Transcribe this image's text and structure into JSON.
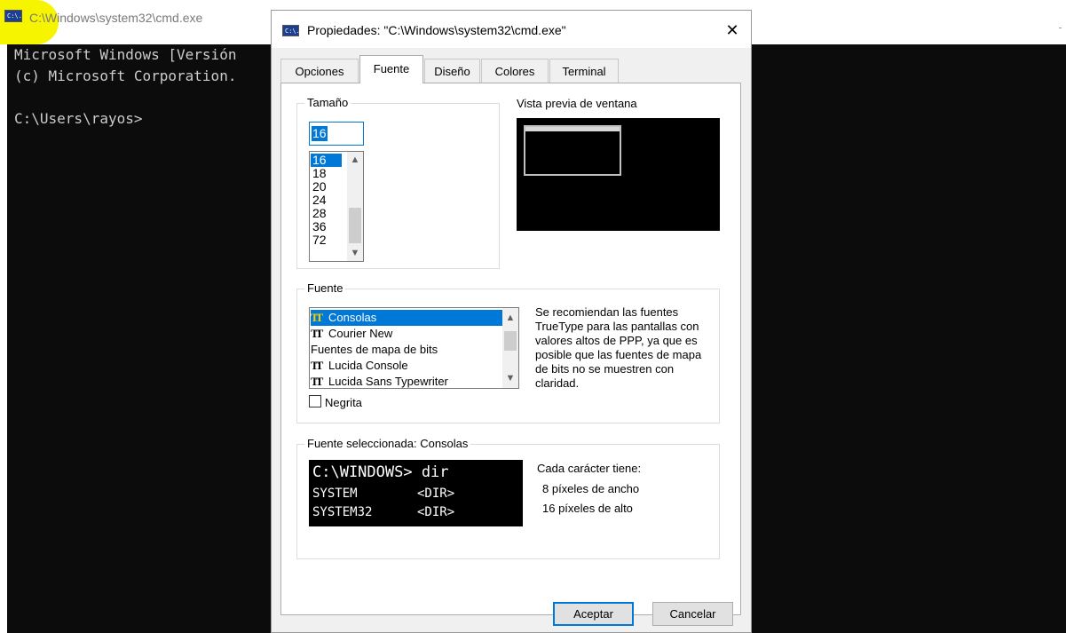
{
  "console": {
    "title": "C:\\Windows\\system32\\cmd.exe",
    "icon_text": "C:\\.",
    "lines": [
      "Microsoft Windows [Versión",
      "(c) Microsoft Corporation.",
      "",
      "C:\\Users\\rayos>"
    ]
  },
  "dialog": {
    "title": "Propiedades: \"C:\\Windows\\system32\\cmd.exe\"",
    "close_glyph": "✕",
    "tabs": [
      "Opciones",
      "Fuente",
      "Diseño",
      "Colores",
      "Terminal"
    ],
    "active_tab": "Fuente",
    "size_group": {
      "label": "Tamaño",
      "input_value": "16",
      "options": [
        "16",
        "18",
        "20",
        "24",
        "28",
        "36",
        "72"
      ],
      "selected": "16"
    },
    "preview": {
      "label": "Vista previa de ventana"
    },
    "font_group": {
      "label": "Fuente",
      "items": [
        {
          "name": "Consolas",
          "icon": "truetype-icon",
          "selected": true
        },
        {
          "name": "Courier New",
          "icon": "truetype-icon",
          "selected": false
        },
        {
          "name": "Fuentes de mapa de bits",
          "icon": "",
          "selected": false
        },
        {
          "name": "Lucida Console",
          "icon": "truetype-icon",
          "selected": false
        },
        {
          "name": "Lucida Sans Typewriter",
          "icon": "truetype-icon",
          "selected": false
        }
      ],
      "hint": "Se recomiendan las fuentes TrueType para las pantallas con valores altos de PPP, ya que es posible que las fuentes de mapa de bits no se muestren con claridad.",
      "bold_label": "Negrita",
      "bold_checked": false
    },
    "selected_font_group": {
      "label": "Fuente seleccionada: Consolas",
      "sample_lines": [
        "C:\\WINDOWS> dir",
        "SYSTEM        <DIR>",
        "SYSTEM32      <DIR>"
      ],
      "info_title": "Cada carácter tiene:",
      "info_width": "8 píxeles de ancho",
      "info_height": "16 píxeles de alto"
    },
    "buttons": {
      "ok": "Aceptar",
      "cancel": "Cancelar"
    }
  },
  "colors": {
    "accent": "#0078d7",
    "highlight": "#f7f400",
    "console_bg": "#0c0c0c",
    "console_text": "#cccccc"
  }
}
